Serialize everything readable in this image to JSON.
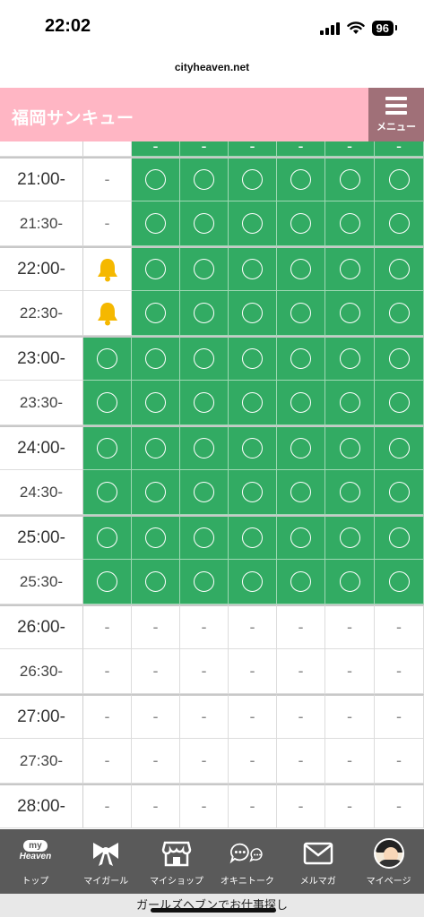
{
  "status": {
    "time": "22:02",
    "battery": "96"
  },
  "browser": {
    "url": "cityheaven.net"
  },
  "header": {
    "title": "福岡サンキュー",
    "menu_label": "メニュー"
  },
  "schedule": {
    "dash": "-",
    "top_row": [
      "-",
      "-",
      "-",
      "-",
      "-",
      "-",
      "-"
    ],
    "rows": [
      {
        "time": "21:00-",
        "slots": [
          "dash",
          "open",
          "open",
          "open",
          "open",
          "open",
          "open"
        ]
      },
      {
        "time": "21:30-",
        "slots": [
          "dash",
          "open",
          "open",
          "open",
          "open",
          "open",
          "open"
        ]
      },
      {
        "time": "22:00-",
        "slots": [
          "bell",
          "open",
          "open",
          "open",
          "open",
          "open",
          "open"
        ]
      },
      {
        "time": "22:30-",
        "slots": [
          "bell",
          "open",
          "open",
          "open",
          "open",
          "open",
          "open"
        ]
      },
      {
        "time": "23:00-",
        "slots": [
          "open",
          "open",
          "open",
          "open",
          "open",
          "open",
          "open"
        ]
      },
      {
        "time": "23:30-",
        "slots": [
          "open",
          "open",
          "open",
          "open",
          "open",
          "open",
          "open"
        ]
      },
      {
        "time": "24:00-",
        "slots": [
          "open",
          "open",
          "open",
          "open",
          "open",
          "open",
          "open"
        ]
      },
      {
        "time": "24:30-",
        "slots": [
          "open",
          "open",
          "open",
          "open",
          "open",
          "open",
          "open"
        ]
      },
      {
        "time": "25:00-",
        "slots": [
          "open",
          "open",
          "open",
          "open",
          "open",
          "open",
          "open"
        ]
      },
      {
        "time": "25:30-",
        "slots": [
          "open",
          "open",
          "open",
          "open",
          "open",
          "open",
          "open"
        ]
      },
      {
        "time": "26:00-",
        "slots": [
          "dash",
          "dash",
          "dash",
          "dash",
          "dash",
          "dash",
          "dash"
        ]
      },
      {
        "time": "26:30-",
        "slots": [
          "dash",
          "dash",
          "dash",
          "dash",
          "dash",
          "dash",
          "dash"
        ]
      },
      {
        "time": "27:00-",
        "slots": [
          "dash",
          "dash",
          "dash",
          "dash",
          "dash",
          "dash",
          "dash"
        ]
      },
      {
        "time": "27:30-",
        "slots": [
          "dash",
          "dash",
          "dash",
          "dash",
          "dash",
          "dash",
          "dash"
        ]
      },
      {
        "time": "28:00-",
        "slots": [
          "dash",
          "dash",
          "dash",
          "dash",
          "dash",
          "dash",
          "dash"
        ]
      }
    ],
    "colors": {
      "open": "#32ab63",
      "bell": "#f5b800"
    }
  },
  "nav": {
    "myheaven_top": "my",
    "myheaven_bottom": "Heaven",
    "items": [
      {
        "label": "トップ",
        "icon": "myheaven-logo-icon"
      },
      {
        "label": "マイガール",
        "icon": "ribbon-icon"
      },
      {
        "label": "マイショップ",
        "icon": "shop-icon"
      },
      {
        "label": "オキニトーク",
        "icon": "chat-bubbles-icon"
      },
      {
        "label": "メルマガ",
        "icon": "mail-icon"
      },
      {
        "label": "マイページ",
        "icon": "avatar-icon"
      }
    ]
  },
  "footer": {
    "text": "ガールズヘブンでお仕事探し"
  }
}
